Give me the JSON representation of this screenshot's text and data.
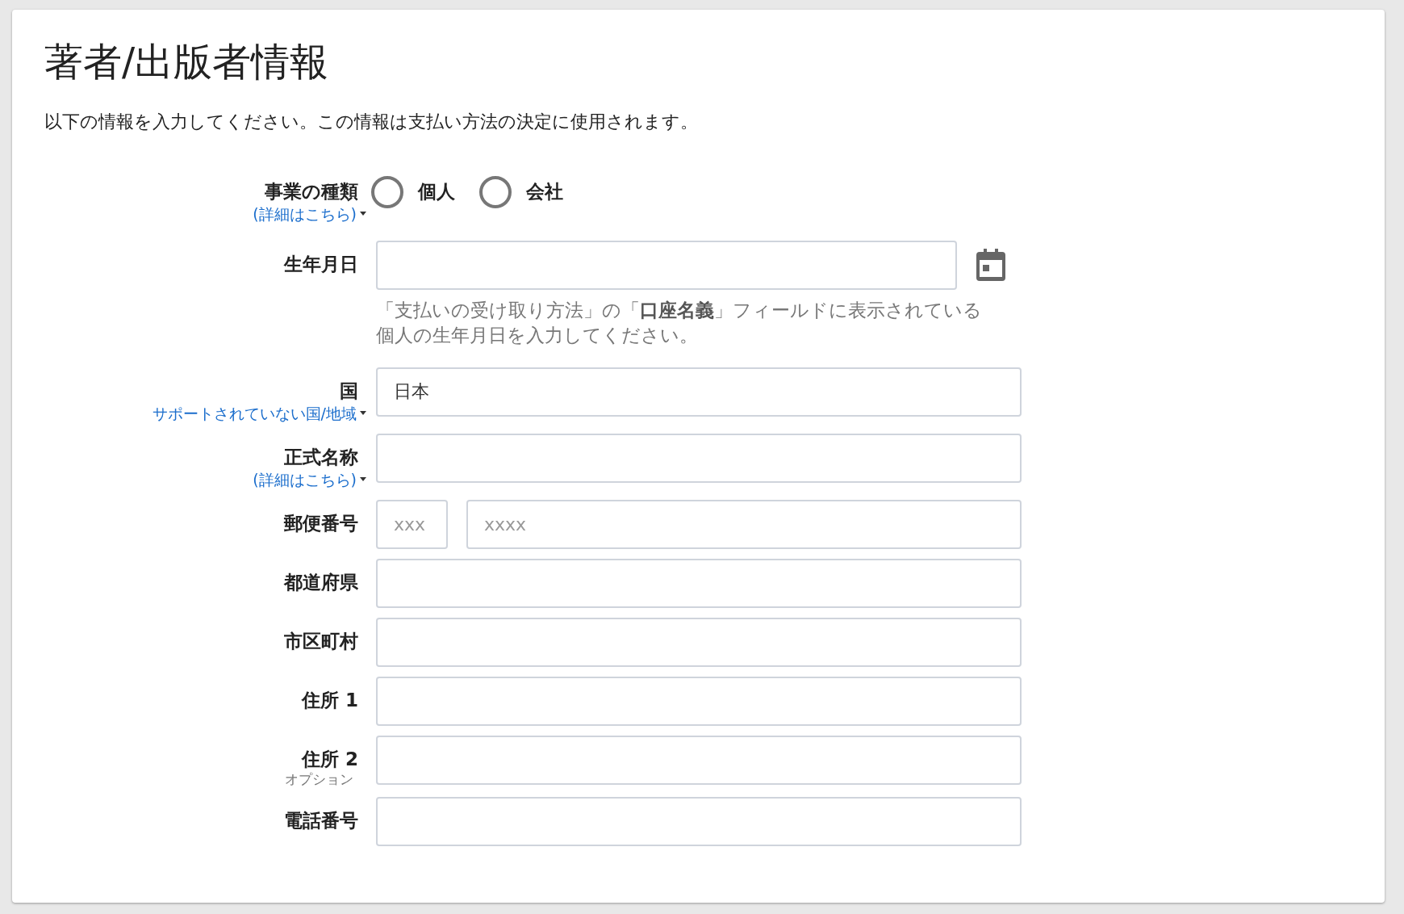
{
  "title": "著者/出版者情報",
  "intro": "以下の情報を入力してください。この情報は支払い方法の決定に使用されます。",
  "fields": [
    {
      "kind": "radio",
      "label": "事業の種類",
      "link": "(詳細はこちら)",
      "options": [
        {
          "label": "個人",
          "selected": false
        },
        {
          "label": "会社",
          "selected": false
        }
      ]
    },
    {
      "kind": "date",
      "label": "生年月日",
      "help": "「支払いの受け取り方法」の「**口座名義**」フィールドに表示されている個人の生年月日を入力してください。"
    },
    {
      "kind": "text",
      "label": "国",
      "link": "サポートされていない国/地域",
      "value": "日本"
    },
    {
      "kind": "text",
      "label": "正式名称",
      "link": "(詳細はこちら)"
    },
    {
      "kind": "postal",
      "label": "郵便番号",
      "inputs": [
        {
          "placeholder": "xxx"
        },
        {
          "placeholder": "xxxx"
        }
      ]
    },
    {
      "kind": "text",
      "label": "都道府県"
    },
    {
      "kind": "text",
      "label": "市区町村"
    },
    {
      "kind": "text",
      "label": "住所 1"
    },
    {
      "kind": "text",
      "label": "住所 2",
      "note": "オプション"
    },
    {
      "kind": "text",
      "label": "電話番号"
    }
  ]
}
